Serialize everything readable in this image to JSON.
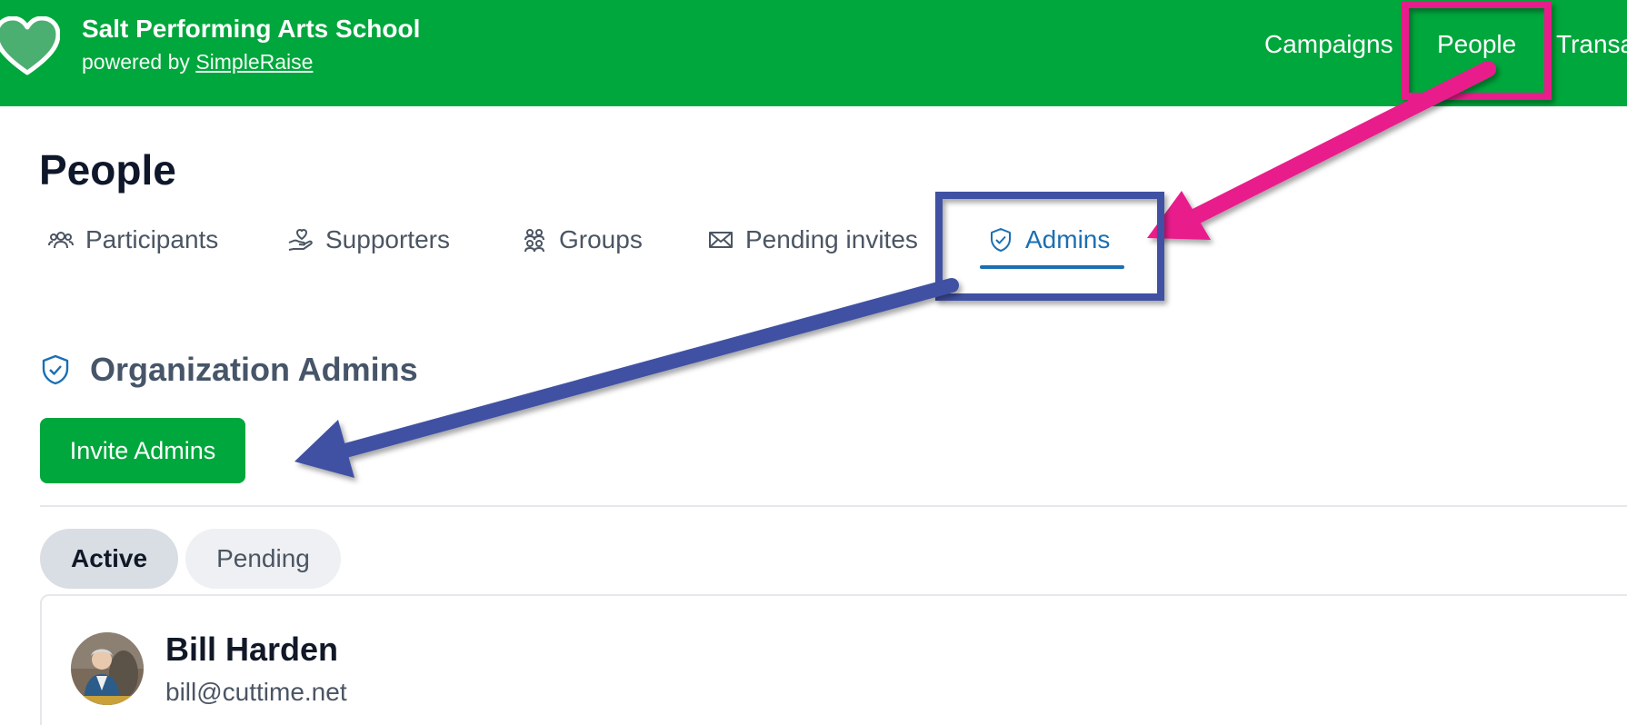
{
  "header": {
    "org_name": "Salt Performing Arts School",
    "powered_prefix": "powered by",
    "powered_link": "SimpleRaise",
    "nav": {
      "campaigns": "Campaigns",
      "people": "People",
      "transactions": "Transa"
    },
    "brand_color": "#00a73c"
  },
  "page": {
    "title": "People",
    "tabs": {
      "participants": "Participants",
      "supporters": "Supporters",
      "groups": "Groups",
      "pending_invites": "Pending invites",
      "admins": "Admins"
    },
    "active_tab": "Admins",
    "accent_color": "#1b6fb3"
  },
  "admins_section": {
    "title": "Organization Admins",
    "invite_button": "Invite Admins",
    "filters": {
      "active": "Active",
      "pending": "Pending"
    },
    "selected_filter": "Active",
    "admins": [
      {
        "name": "Bill Harden",
        "email": "bill@cuttime.net"
      }
    ]
  },
  "annotations": {
    "highlight_magenta": "#e91e8c",
    "highlight_blue": "#3f51a3"
  }
}
